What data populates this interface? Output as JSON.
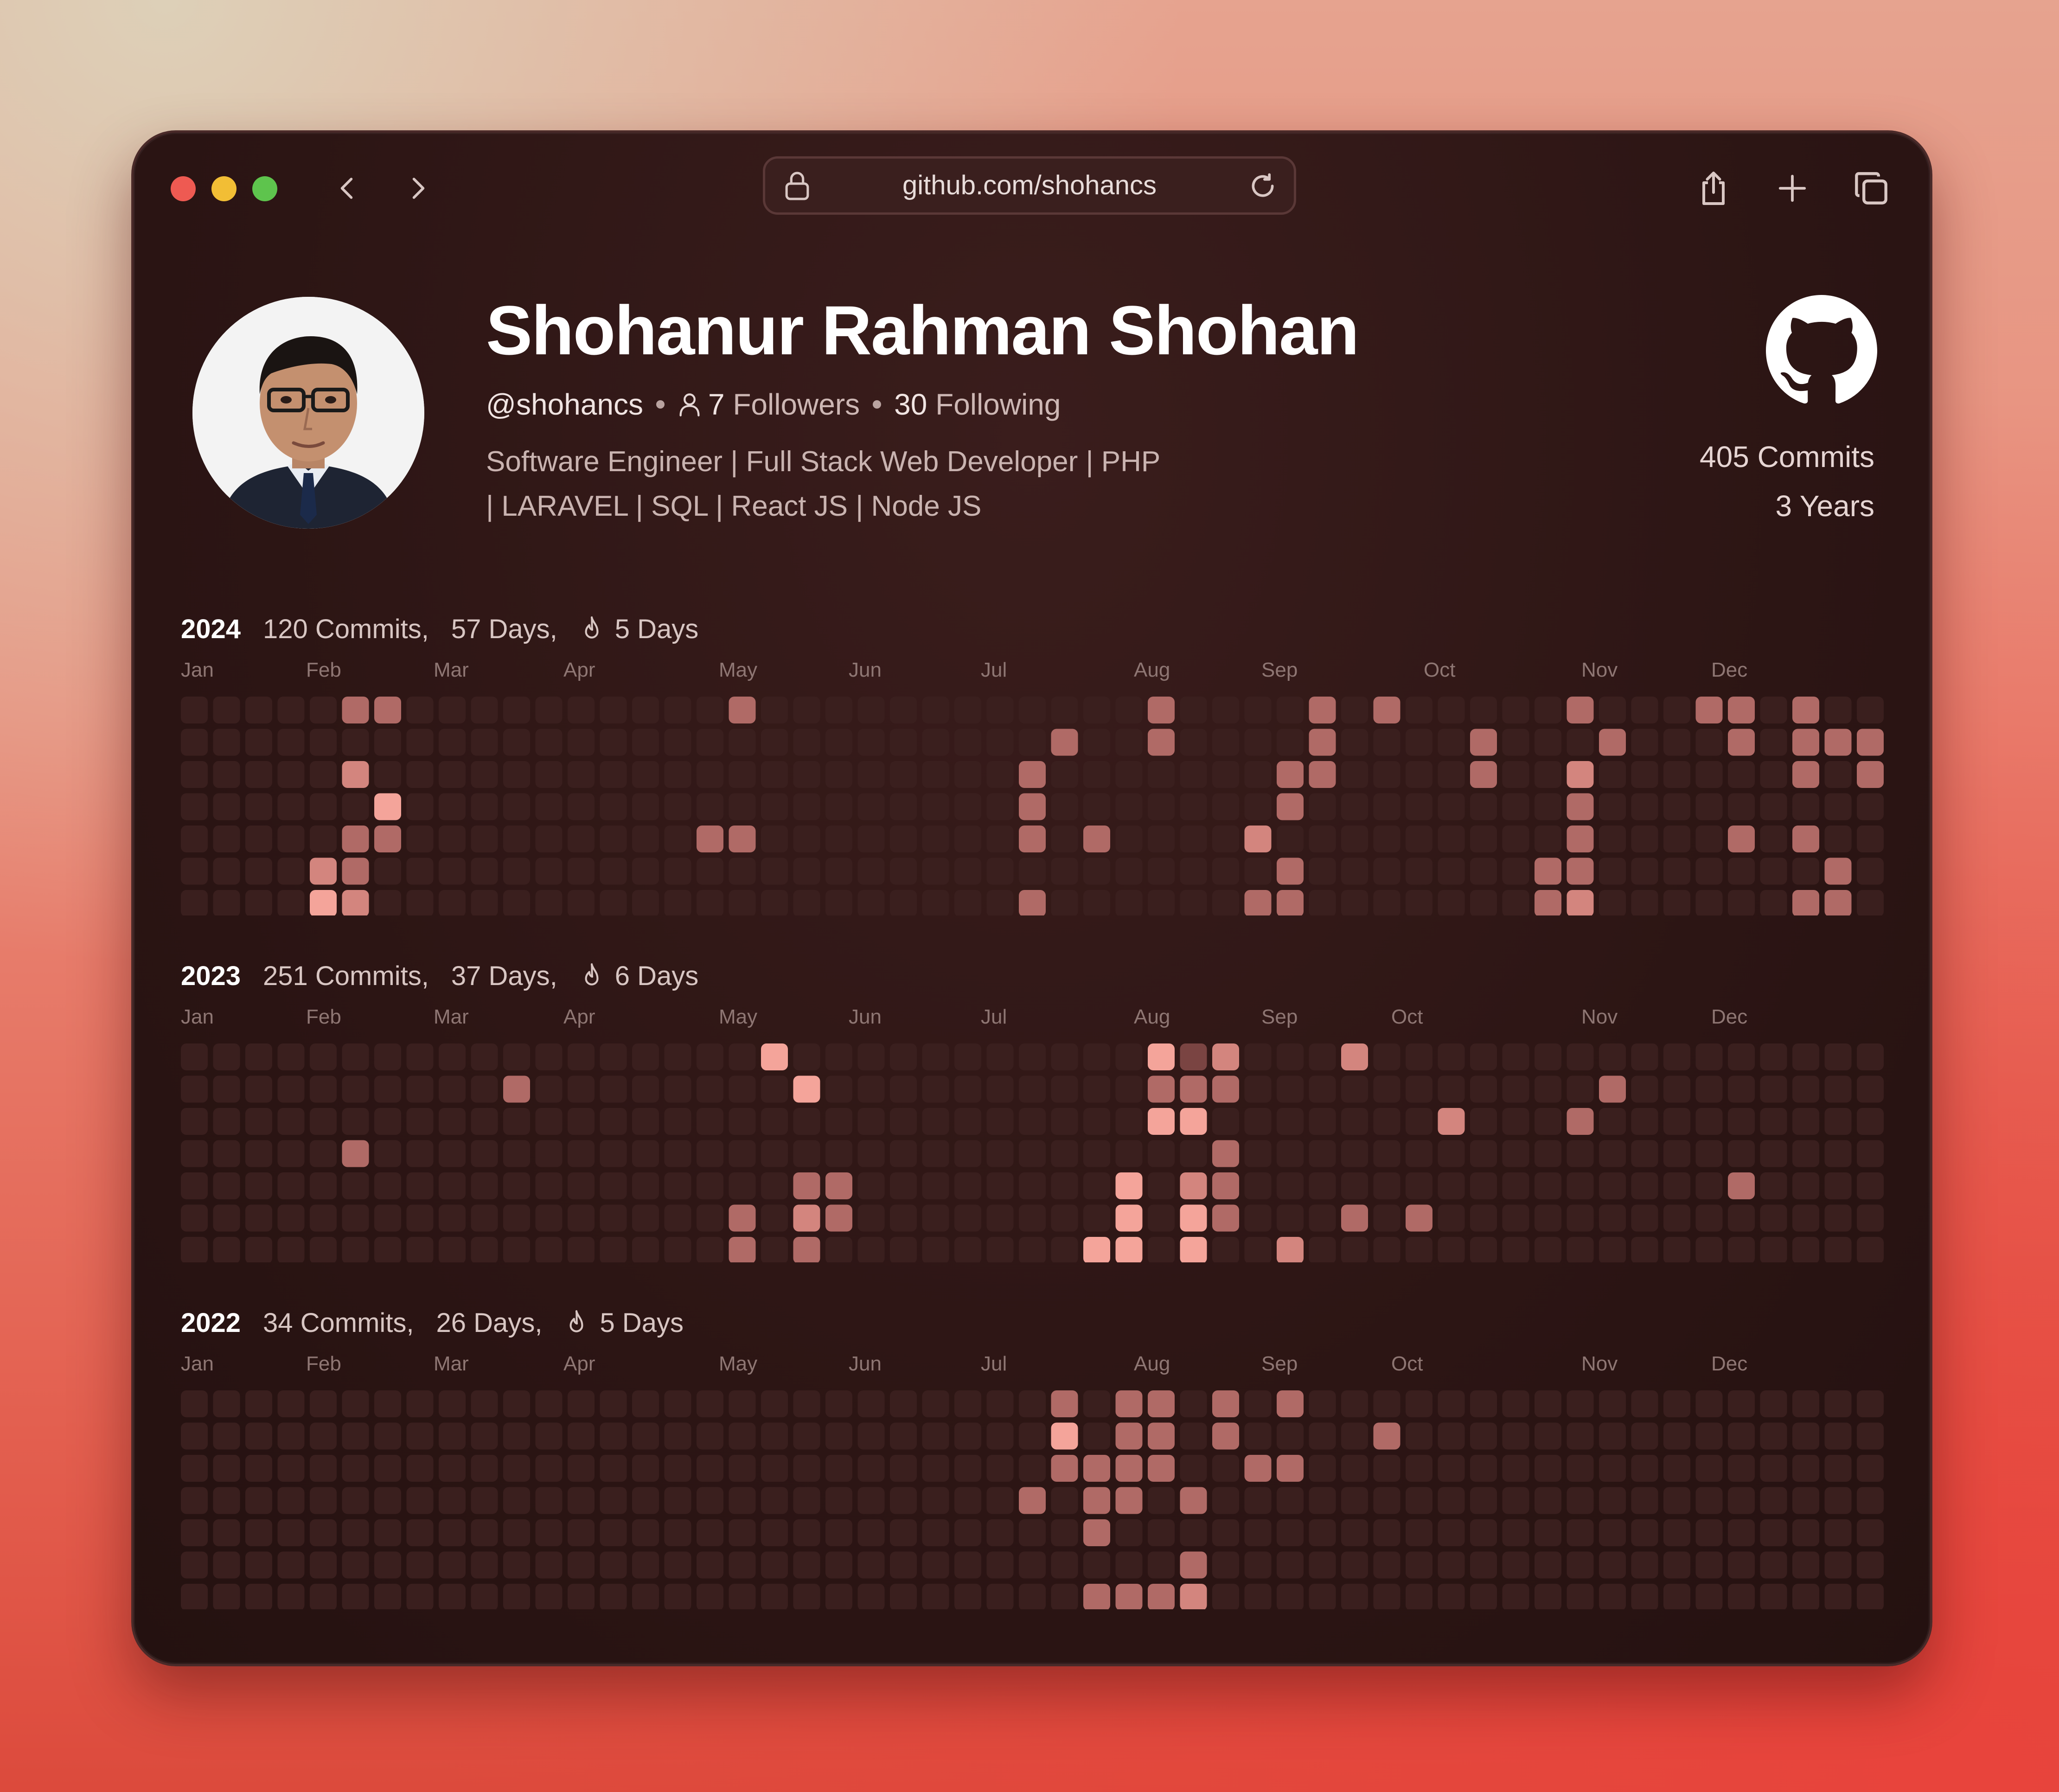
{
  "browser": {
    "url": "github.com/shohancs",
    "icons": {
      "back": "chevron-left-icon",
      "forward": "chevron-right-icon",
      "lock": "lock-icon",
      "reload": "reload-icon",
      "share": "share-icon",
      "new_tab": "plus-icon",
      "tabs": "tabs-icon"
    }
  },
  "profile": {
    "name": "Shohanur Rahman Shohan",
    "username": "@shohancs",
    "followers_count": "7",
    "followers_label": "Followers",
    "following_count": "30",
    "following_label": "Following",
    "bio_line1": "Software Engineer | Full Stack Web Developer | PHP",
    "bio_line2": "| LARAVEL | SQL | React JS | Node JS",
    "total_commits": "405 Commits",
    "years": "3 Years"
  },
  "colors": {
    "empty_cell": "#3a1f1e",
    "level1": "#7a4442",
    "level2": "#b06a66",
    "level3": "#d3857e",
    "level4": "#f4a49a"
  },
  "month_labels": [
    "Jan",
    "Feb",
    "Mar",
    "Apr",
    "May",
    "Jun",
    "Jul",
    "Aug",
    "Sep",
    "Oct",
    "Nov",
    "Dec"
  ],
  "years": [
    {
      "year": "2024",
      "commits": "120 Commits,",
      "days": "57 Days,",
      "streak": "5 Days",
      "cells": [
        [
          5,
          0,
          2
        ],
        [
          6,
          0,
          2
        ],
        [
          17,
          0,
          2
        ],
        [
          30,
          0,
          2
        ],
        [
          35,
          0,
          2
        ],
        [
          37,
          0,
          2
        ],
        [
          43,
          0,
          2
        ],
        [
          47,
          0,
          2
        ],
        [
          48,
          0,
          2
        ],
        [
          50,
          0,
          2
        ],
        [
          27,
          1,
          2
        ],
        [
          30,
          1,
          2
        ],
        [
          35,
          1,
          2
        ],
        [
          40,
          1,
          2
        ],
        [
          44,
          1,
          2
        ],
        [
          48,
          1,
          2
        ],
        [
          50,
          1,
          2
        ],
        [
          51,
          1,
          2
        ],
        [
          52,
          1,
          2
        ],
        [
          5,
          2,
          3
        ],
        [
          26,
          2,
          2
        ],
        [
          34,
          2,
          2
        ],
        [
          35,
          2,
          2
        ],
        [
          40,
          2,
          2
        ],
        [
          43,
          2,
          3
        ],
        [
          50,
          2,
          2
        ],
        [
          52,
          2,
          2
        ],
        [
          6,
          3,
          4
        ],
        [
          26,
          3,
          2
        ],
        [
          34,
          3,
          2
        ],
        [
          43,
          3,
          2
        ],
        [
          5,
          4,
          2
        ],
        [
          6,
          4,
          2
        ],
        [
          16,
          4,
          2
        ],
        [
          17,
          4,
          2
        ],
        [
          26,
          4,
          2
        ],
        [
          28,
          4,
          2
        ],
        [
          33,
          4,
          3
        ],
        [
          43,
          4,
          2
        ],
        [
          48,
          4,
          2
        ],
        [
          50,
          4,
          2
        ],
        [
          4,
          5,
          3
        ],
        [
          5,
          5,
          2
        ],
        [
          34,
          5,
          2
        ],
        [
          42,
          5,
          2
        ],
        [
          43,
          5,
          2
        ],
        [
          51,
          5,
          2
        ],
        [
          4,
          6,
          4
        ],
        [
          5,
          6,
          3
        ],
        [
          26,
          6,
          2
        ],
        [
          33,
          6,
          2
        ],
        [
          34,
          6,
          2
        ],
        [
          42,
          6,
          2
        ],
        [
          43,
          6,
          3
        ],
        [
          50,
          6,
          2
        ],
        [
          51,
          6,
          2
        ]
      ]
    },
    {
      "year": "2023",
      "commits": "251 Commits,",
      "days": "37 Days,",
      "streak": "6 Days",
      "cells": [
        [
          18,
          0,
          4
        ],
        [
          30,
          0,
          4
        ],
        [
          31,
          0,
          1
        ],
        [
          32,
          0,
          3
        ],
        [
          36,
          0,
          3
        ],
        [
          10,
          1,
          2
        ],
        [
          19,
          1,
          4
        ],
        [
          30,
          1,
          2
        ],
        [
          31,
          1,
          2
        ],
        [
          32,
          1,
          2
        ],
        [
          44,
          1,
          2
        ],
        [
          30,
          2,
          4
        ],
        [
          31,
          2,
          4
        ],
        [
          39,
          2,
          3
        ],
        [
          43,
          2,
          2
        ],
        [
          5,
          3,
          2
        ],
        [
          32,
          3,
          2
        ],
        [
          19,
          4,
          2
        ],
        [
          20,
          4,
          2
        ],
        [
          29,
          4,
          4
        ],
        [
          31,
          4,
          3
        ],
        [
          32,
          4,
          2
        ],
        [
          48,
          4,
          2
        ],
        [
          17,
          5,
          2
        ],
        [
          19,
          5,
          3
        ],
        [
          20,
          5,
          2
        ],
        [
          29,
          5,
          4
        ],
        [
          31,
          5,
          4
        ],
        [
          32,
          5,
          2
        ],
        [
          36,
          5,
          2
        ],
        [
          38,
          5,
          2
        ],
        [
          17,
          6,
          2
        ],
        [
          19,
          6,
          2
        ],
        [
          28,
          6,
          4
        ],
        [
          29,
          6,
          4
        ],
        [
          31,
          6,
          4
        ],
        [
          34,
          6,
          3
        ]
      ]
    },
    {
      "year": "2022",
      "commits": "34 Commits,",
      "days": "26 Days,",
      "streak": "5 Days",
      "cells": [
        [
          27,
          0,
          2
        ],
        [
          29,
          0,
          2
        ],
        [
          30,
          0,
          2
        ],
        [
          32,
          0,
          2
        ],
        [
          34,
          0,
          2
        ],
        [
          27,
          1,
          4
        ],
        [
          29,
          1,
          2
        ],
        [
          30,
          1,
          2
        ],
        [
          32,
          1,
          2
        ],
        [
          37,
          1,
          2
        ],
        [
          27,
          2,
          2
        ],
        [
          28,
          2,
          2
        ],
        [
          29,
          2,
          2
        ],
        [
          30,
          2,
          2
        ],
        [
          33,
          2,
          2
        ],
        [
          34,
          2,
          2
        ],
        [
          26,
          3,
          2
        ],
        [
          28,
          3,
          2
        ],
        [
          29,
          3,
          2
        ],
        [
          31,
          3,
          2
        ],
        [
          28,
          4,
          2
        ],
        [
          31,
          5,
          2
        ],
        [
          28,
          6,
          2
        ],
        [
          29,
          6,
          2
        ],
        [
          30,
          6,
          2
        ],
        [
          31,
          6,
          3
        ]
      ]
    }
  ]
}
